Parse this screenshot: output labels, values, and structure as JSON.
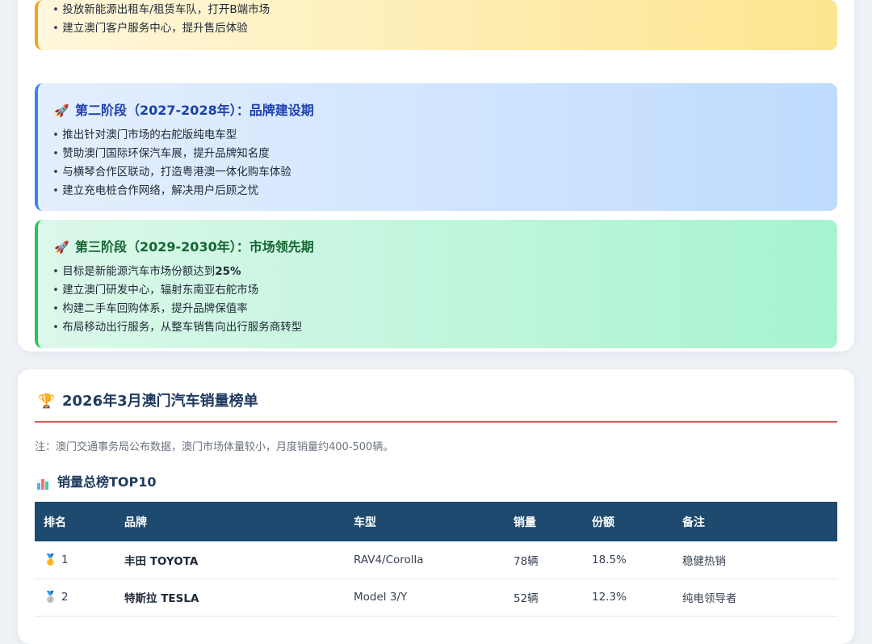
{
  "roadmap": {
    "stage1": {
      "bullets": [
        "投放新能源出租车/租赁车队，打开B端市场",
        "建立澳门客户服务中心，提升售后体验"
      ]
    },
    "stage2": {
      "icon": "rocket-icon",
      "title": "第二阶段（2027-2028年）：品牌建设期",
      "bullets": [
        "推出针对澳门市场的右舵版纯电车型",
        "赞助澳门国际环保汽车展，提升品牌知名度",
        "与横琴合作区联动，打造粤港澳一体化购车体验",
        "建立充电桩合作网络，解决用户后顾之忧"
      ]
    },
    "stage3": {
      "icon": "rocket-icon",
      "title": "第三阶段（2029-2030年）：市场领先期",
      "bullet1_prefix": "目标是新能源汽车市场份额达到",
      "bullet1_highlight": "25%",
      "bullets": [
        "建立澳门研发中心，辐射东南亚右舵市场",
        "构建二手车回购体系，提升品牌保值率",
        "布局移动出行服务，从整车销售向出行服务商转型"
      ]
    }
  },
  "sales_section": {
    "icon": "trophy-icon",
    "title": "2026年3月澳门汽车销量榜单",
    "note": "注：澳门交通事务局公布数据，澳门市场体量较小，月度销量约400-500辆。",
    "subtitle_icon": "bar-chart-icon",
    "subtitle": "销量总榜TOP10",
    "columns": [
      "排名",
      "品牌",
      "车型",
      "销量",
      "份额",
      "备注"
    ],
    "rows": [
      {
        "medal": "gold-medal-icon",
        "rank": "1",
        "brand": "丰田 TOYOTA",
        "model": "RAV4/Corolla",
        "sales": "78辆",
        "share": "18.5%",
        "note": "稳健热销"
      },
      {
        "medal": "silver-medal-icon",
        "rank": "2",
        "brand": "特斯拉 TESLA",
        "model": "Model 3/Y",
        "sales": "52辆",
        "share": "12.3%",
        "note": "纯电领导者"
      }
    ]
  },
  "colors": {
    "stage1_accent": "#f2a51c",
    "stage2_accent": "#3b82f6",
    "stage3_accent": "#22c55e",
    "section_rule": "#e0554b",
    "table_header": "#1d4a6e"
  }
}
